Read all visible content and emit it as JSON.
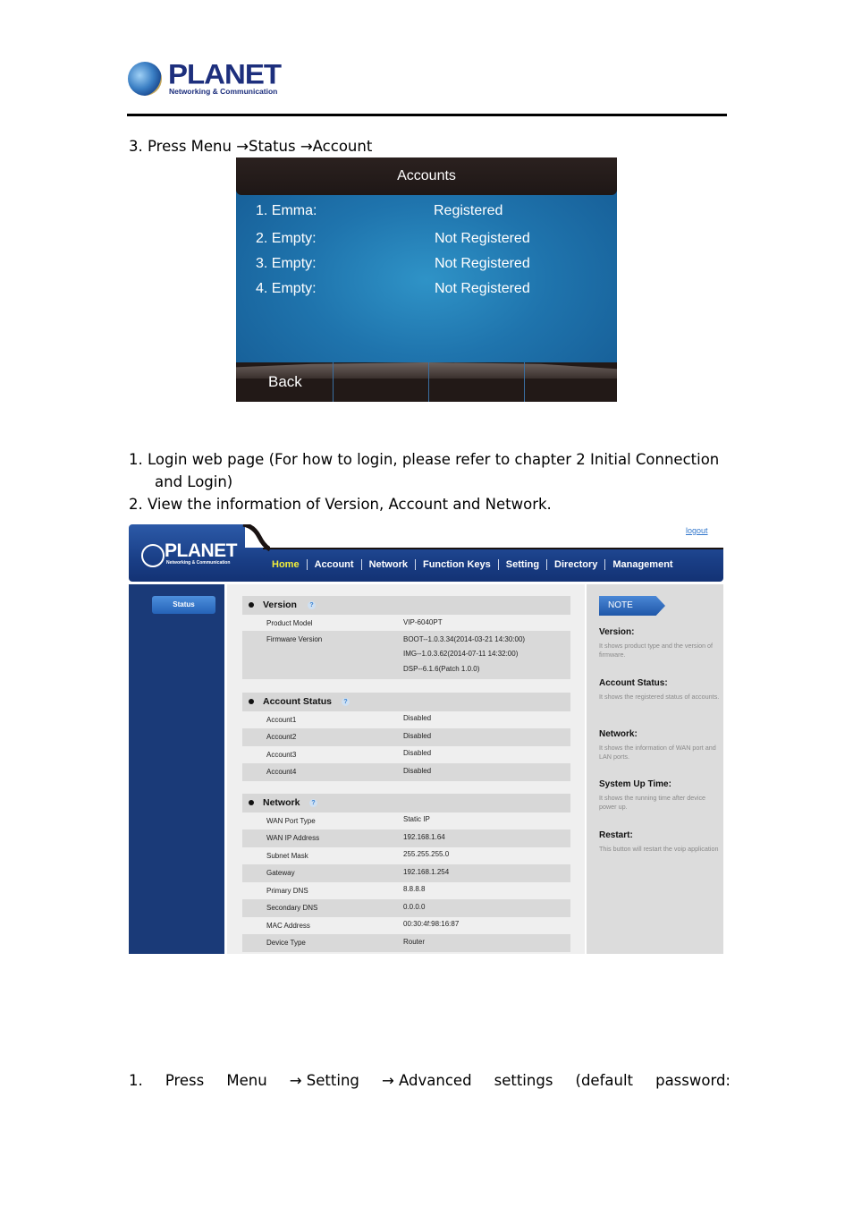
{
  "header": {
    "brand": "PLANET",
    "tagline": "Networking & Communication"
  },
  "steps_top": {
    "step3": "3.  Press Menu →Status →Account"
  },
  "phone_screen": {
    "title": "Accounts",
    "accounts": [
      {
        "label": "1. Emma:",
        "status": "Registered"
      },
      {
        "label": "2. Empty:",
        "status": "Not Registered"
      },
      {
        "label": "3. Empty:",
        "status": "Not Registered"
      },
      {
        "label": "4. Empty:",
        "status": "Not Registered"
      }
    ],
    "softkeys": [
      "Back",
      "",
      "",
      ""
    ]
  },
  "steps_web": {
    "step1_line1": "1.  Login web page (For how to login, please refer to chapter 2 Initial Connection",
    "step1_line2": "and Login)",
    "step2": "2.  View the information of Version, Account and Network."
  },
  "web_ui": {
    "brand": "PLANET",
    "tagline": "Networking & Communication",
    "logout": "logout",
    "nav": [
      "Home",
      "Account",
      "Network",
      "Function Keys",
      "Setting",
      "Directory",
      "Management"
    ],
    "active_nav": "Home",
    "sidebar_button": "Status",
    "version": {
      "title": "Version",
      "help": "?",
      "rows": [
        {
          "key": "Product Model",
          "values": [
            "VIP-6040PT"
          ]
        },
        {
          "key": "Firmware Version",
          "values": [
            "BOOT--1.0.3.34(2014-03-21 14:30:00)",
            "IMG--1.0.3.62(2014-07-11 14:32:00)",
            "DSP--6.1.6(Patch 1.0.0)"
          ]
        }
      ]
    },
    "account_status": {
      "title": "Account Status",
      "help": "?",
      "rows": [
        {
          "key": "Account1",
          "value": "Disabled"
        },
        {
          "key": "Account2",
          "value": "Disabled"
        },
        {
          "key": "Account3",
          "value": "Disabled"
        },
        {
          "key": "Account4",
          "value": "Disabled"
        }
      ]
    },
    "network": {
      "title": "Network",
      "help": "?",
      "rows": [
        {
          "key": "WAN Port Type",
          "value": "Static IP"
        },
        {
          "key": "WAN IP Address",
          "value": "192.168.1.64"
        },
        {
          "key": "Subnet Mask",
          "value": "255.255.255.0"
        },
        {
          "key": "Gateway",
          "value": "192.168.1.254"
        },
        {
          "key": "Primary DNS",
          "value": "8.8.8.8"
        },
        {
          "key": "Secondary DNS",
          "value": "0.0.0.0"
        },
        {
          "key": "MAC Address",
          "value": "00:30:4f:98:16:87"
        },
        {
          "key": "Device Type",
          "value": "Router"
        }
      ]
    },
    "note": {
      "tag": "NOTE",
      "items": [
        {
          "title": "Version:",
          "text": "It shows product type and the version of firmware."
        },
        {
          "title": "Account Status:",
          "text": "It shows the registered status of accounts."
        },
        {
          "title": "Network:",
          "text": "It shows the information of WAN port and LAN ports."
        },
        {
          "title": "System Up Time:",
          "text": "It shows the running time after device power up."
        },
        {
          "title": "Restart:",
          "text": "This button will restart the voip application"
        }
      ]
    }
  },
  "steps_bottom": {
    "words": [
      "1.",
      "Press",
      "Menu",
      "→ Setting",
      "→ Advanced",
      "settings",
      "(default",
      "password:"
    ]
  },
  "colors": {
    "web_nav_active": "#f2ee3a",
    "web_banner": "#1a3f87",
    "phone_bg": "#1f74ad"
  }
}
